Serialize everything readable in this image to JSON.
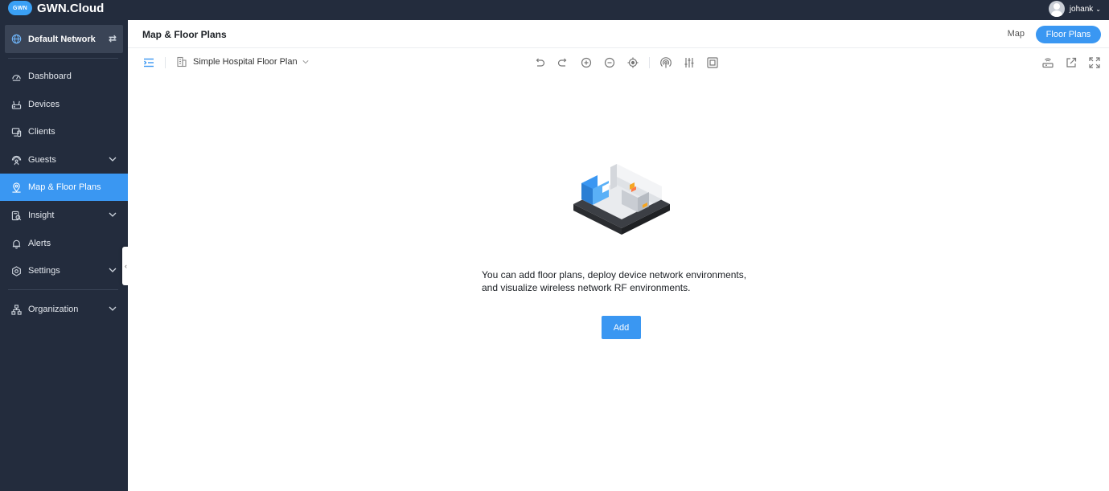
{
  "app": {
    "logo_badge": "GWN",
    "logo_text": "GWN.Cloud",
    "user_name": "johank"
  },
  "sidebar": {
    "network": "Default Network",
    "items": [
      {
        "label": "Dashboard",
        "icon": "dashboard-icon"
      },
      {
        "label": "Devices",
        "icon": "devices-icon"
      },
      {
        "label": "Clients",
        "icon": "clients-icon"
      },
      {
        "label": "Guests",
        "icon": "guests-icon",
        "expandable": true
      },
      {
        "label": "Map & Floor Plans",
        "icon": "map-pin-icon",
        "active": true
      },
      {
        "label": "Insight",
        "icon": "insight-icon",
        "expandable": true
      },
      {
        "label": "Alerts",
        "icon": "bell-icon"
      },
      {
        "label": "Settings",
        "icon": "gear-icon",
        "expandable": true
      },
      {
        "label": "Organization",
        "icon": "organization-icon",
        "expandable": true
      }
    ]
  },
  "header": {
    "title": "Map & Floor Plans",
    "tab_map": "Map",
    "tab_floor_plans": "Floor Plans"
  },
  "toolbar": {
    "floor_plan_name": "Simple Hospital Floor Plan"
  },
  "empty_state": {
    "line1": "You can add floor plans, deploy device network environments,",
    "line2": "and visualize wireless network RF environments.",
    "add_label": "Add"
  },
  "colors": {
    "accent": "#3a97f2",
    "sidebar_bg": "#232c3d"
  }
}
